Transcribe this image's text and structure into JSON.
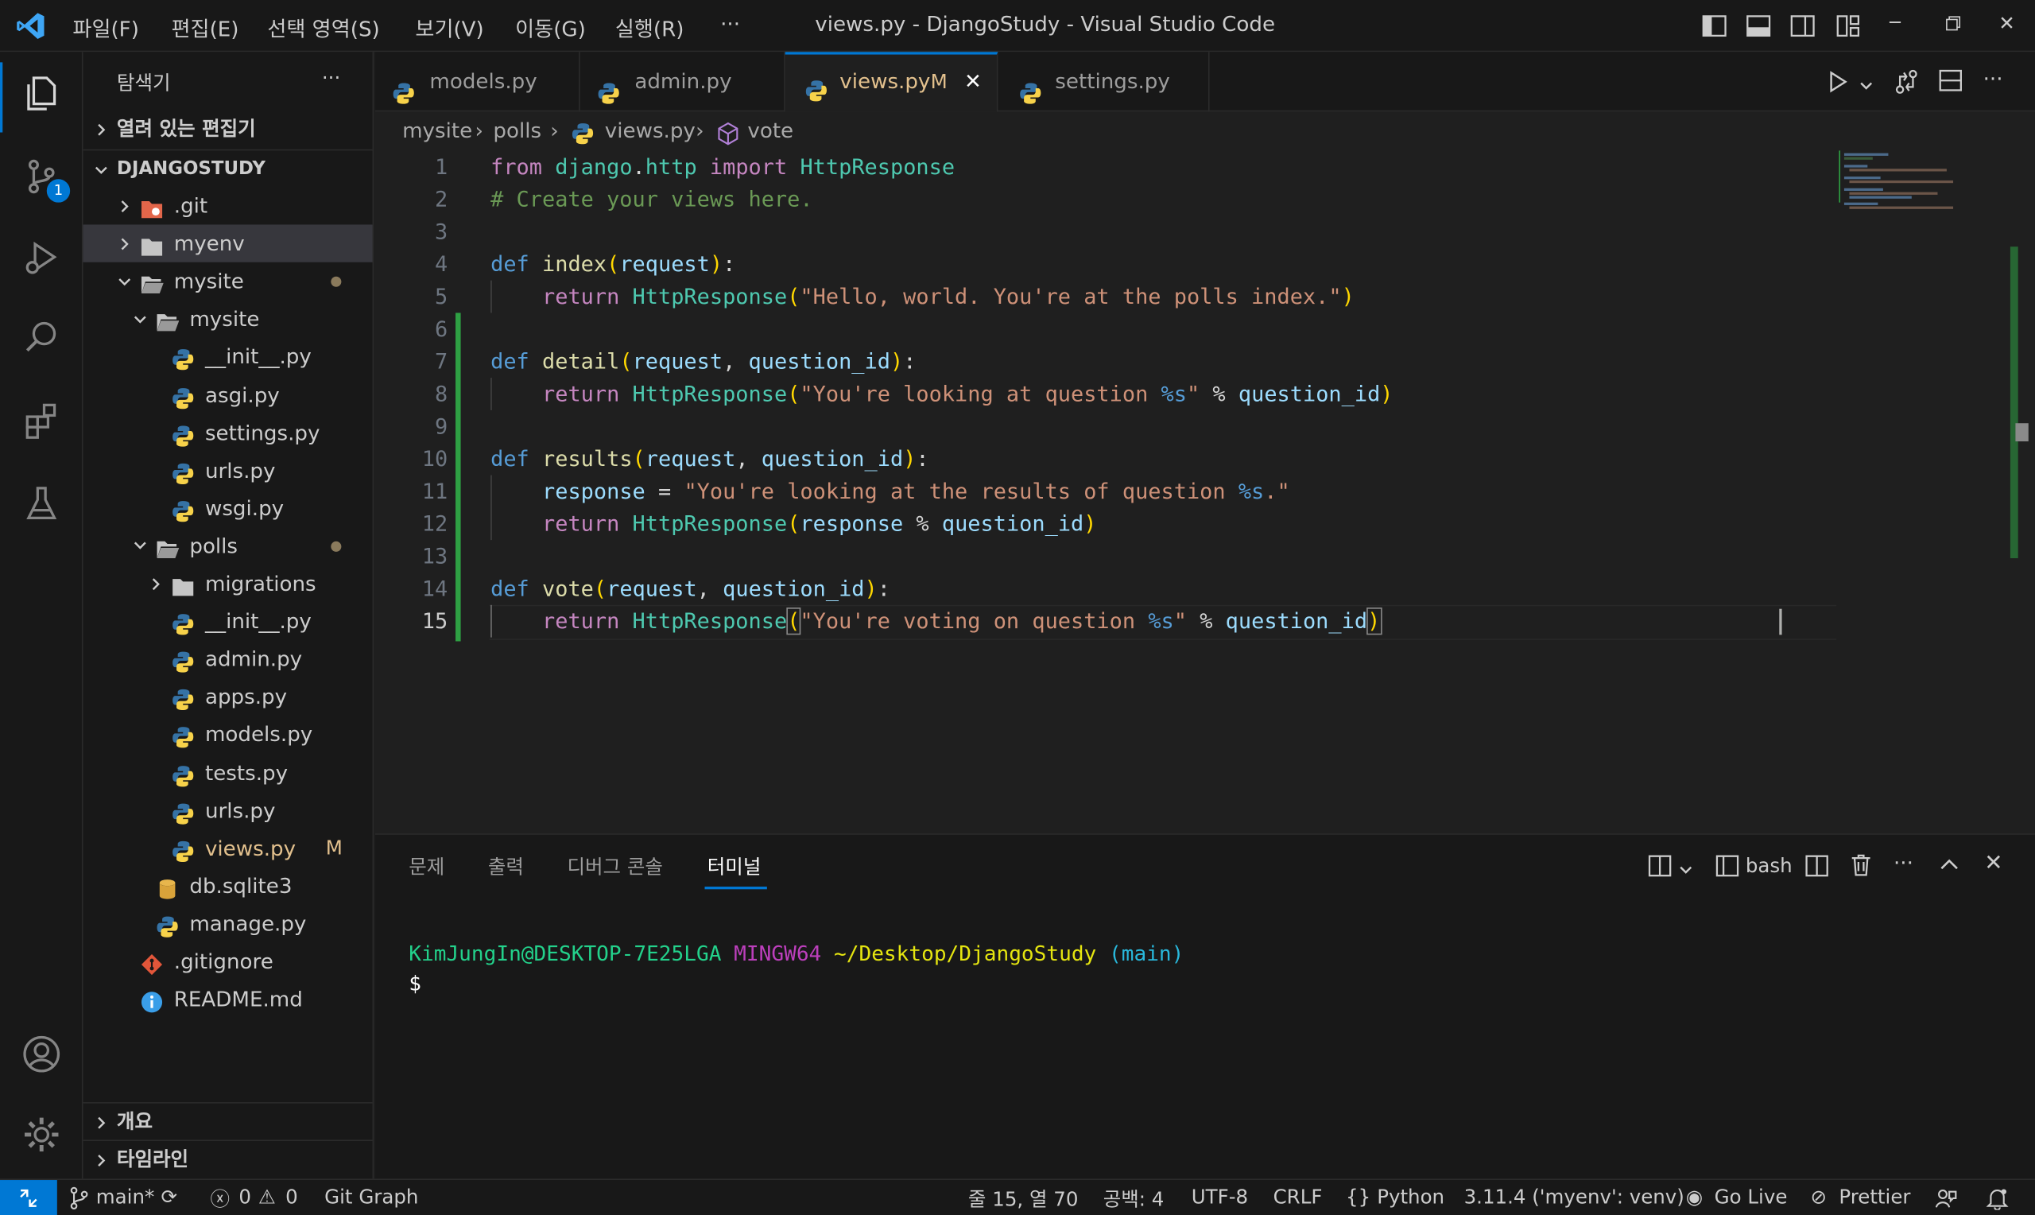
{
  "window": {
    "title": "views.py - DjangoStudy - Visual Studio Code",
    "menu": [
      "파일(F)",
      "편집(E)",
      "선택 영역(S)",
      "보기(V)",
      "이동(G)",
      "실행(R)",
      "···"
    ]
  },
  "activity": {
    "scm_badge": "1"
  },
  "sidebar": {
    "header": "탐색기",
    "more": "···",
    "open_editors": "열려 있는 편집기",
    "root": "DJANGOSTUDY",
    "tree": [
      {
        "label": ".git",
        "icon": "git-folder-icon"
      },
      {
        "label": "myenv",
        "icon": "folder-icon"
      },
      {
        "label": "mysite",
        "icon": "folder-open-icon"
      },
      {
        "label": "mysite",
        "icon": "folder-open-icon"
      },
      {
        "label": "__init__.py",
        "icon": "python-icon"
      },
      {
        "label": "asgi.py",
        "icon": "python-icon"
      },
      {
        "label": "settings.py",
        "icon": "python-icon"
      },
      {
        "label": "urls.py",
        "icon": "python-icon"
      },
      {
        "label": "wsgi.py",
        "icon": "python-icon"
      },
      {
        "label": "polls",
        "icon": "folder-open-icon"
      },
      {
        "label": "migrations",
        "icon": "folder-icon"
      },
      {
        "label": "__init__.py",
        "icon": "python-icon"
      },
      {
        "label": "admin.py",
        "icon": "python-icon"
      },
      {
        "label": "apps.py",
        "icon": "python-icon"
      },
      {
        "label": "models.py",
        "icon": "python-icon"
      },
      {
        "label": "tests.py",
        "icon": "python-icon"
      },
      {
        "label": "urls.py",
        "icon": "python-icon"
      },
      {
        "label": "views.py",
        "icon": "python-icon",
        "badge": "M"
      },
      {
        "label": "db.sqlite3",
        "icon": "database-icon"
      },
      {
        "label": "manage.py",
        "icon": "python-icon"
      },
      {
        "label": ".gitignore",
        "icon": "git-icon"
      },
      {
        "label": "README.md",
        "icon": "info-icon"
      }
    ],
    "outline": "개요",
    "timeline": "타임라인"
  },
  "tabs": [
    {
      "label": "models.py"
    },
    {
      "label": "admin.py"
    },
    {
      "label": "views.py",
      "badge": "M",
      "close": "✕"
    },
    {
      "label": "settings.py"
    }
  ],
  "breadcrumb": [
    "mysite",
    "polls",
    "views.py",
    "vote"
  ],
  "editor": {
    "line_numbers": [
      "1",
      "2",
      "3",
      "4",
      "5",
      "6",
      "7",
      "8",
      "9",
      "10",
      "11",
      "12",
      "13",
      "14",
      "15"
    ],
    "current_line": "15"
  },
  "panel": {
    "tabs": [
      "문제",
      "출력",
      "디버그 콘솔",
      "터미널"
    ],
    "active_tab": "터미널",
    "shell": "bash",
    "terminal": {
      "user": "KimJungIn@DESKTOP-7E25LGA",
      "env": "MINGW64",
      "path": "~/Desktop/DjangoStudy",
      "branch": "(main)",
      "prompt": "$"
    }
  },
  "status": {
    "branch": "main*",
    "errors": "0",
    "warnings": "0",
    "git_graph": "Git Graph",
    "position": "줄 15, 열 70",
    "spaces": "공백: 4",
    "encoding": "UTF-8",
    "eol": "CRLF",
    "language": "Python",
    "interpreter": "3.11.4 ('myenv': venv)",
    "go_live": "Go Live",
    "prettier": "Prettier"
  },
  "colors": {
    "accent": "#0078d4",
    "status_remote": "#0078d4",
    "modified": "#e2c08d",
    "added_gutter": "#2ea043"
  }
}
